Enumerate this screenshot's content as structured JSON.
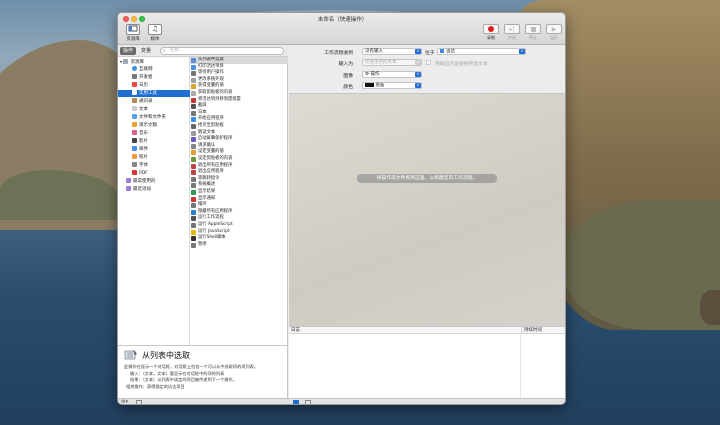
{
  "window": {
    "title": "未命名（快速操作）"
  },
  "toolbar": {
    "library": "资源库",
    "media": "媒体",
    "record": "录制",
    "step": "步进",
    "stop": "停止",
    "run": "运行"
  },
  "tabs": {
    "actions": "操作",
    "variables": "变量",
    "search_placeholder": "名称"
  },
  "library": [
    "资源库",
    "互联网",
    "开发者",
    "日历",
    "实用工具",
    "通讯录",
    "文本",
    "文件和文件夹",
    "演示文稿",
    "音乐",
    "影片",
    "邮件",
    "照片",
    "字体",
    "PDF",
    "最常使用的",
    "最近添加"
  ],
  "actions": [
    "从列表中选取",
    "打印活达项目",
    "等待用户操作",
    "更改系统外观",
    "获得变量的值",
    "获取剪贴板的内容",
    "将活达项目移到废纸篓",
    "截屏",
    "日本",
    "开始应用程序",
    "拷贝至剪贴板",
    "朗读文本",
    "启动屏幕保护程序",
    "请求确认",
    "设定变量的值",
    "设定剪贴板的内容",
    "退出所有应用程序",
    "退出应用程序",
    "等跳转指令",
    "系统概述",
    "显示结果",
    "显示通知",
    "循环",
    "隐藏所有应用程序",
    "运行工作流程",
    "运行 AppleScript",
    "运行 JavaScript",
    "运行Shell脚本",
    "暂停"
  ],
  "description": {
    "title": "从列表中选取",
    "line1": "此操作在显示一个对话框，对话框上包含一个可以从中选取项的项列表。",
    "line2": "输入：（文本，文本）要显示在对话框中的项的列表",
    "line3": "结果：（文本）从列表中选定的项目被传递到下一个操作。",
    "line4": "相关操作：获得指定的访达项目"
  },
  "workflow": {
    "receives_label": "工作流程收到",
    "receives_value": "没有输入",
    "in_label": "位于",
    "in_value": "访达",
    "input_label": "输入为",
    "input_value": "仅限主用的文本",
    "replace_label": "用输出内容替换所选文本",
    "image_label": "图像",
    "image_value": "操作",
    "color_label": "颜色",
    "color_value": "黑色",
    "canvas_hint": "将操作或文件拖到这里，以构建您的工作流程。"
  },
  "log": {
    "col_log": "日志",
    "col_duration": "持续时间"
  }
}
